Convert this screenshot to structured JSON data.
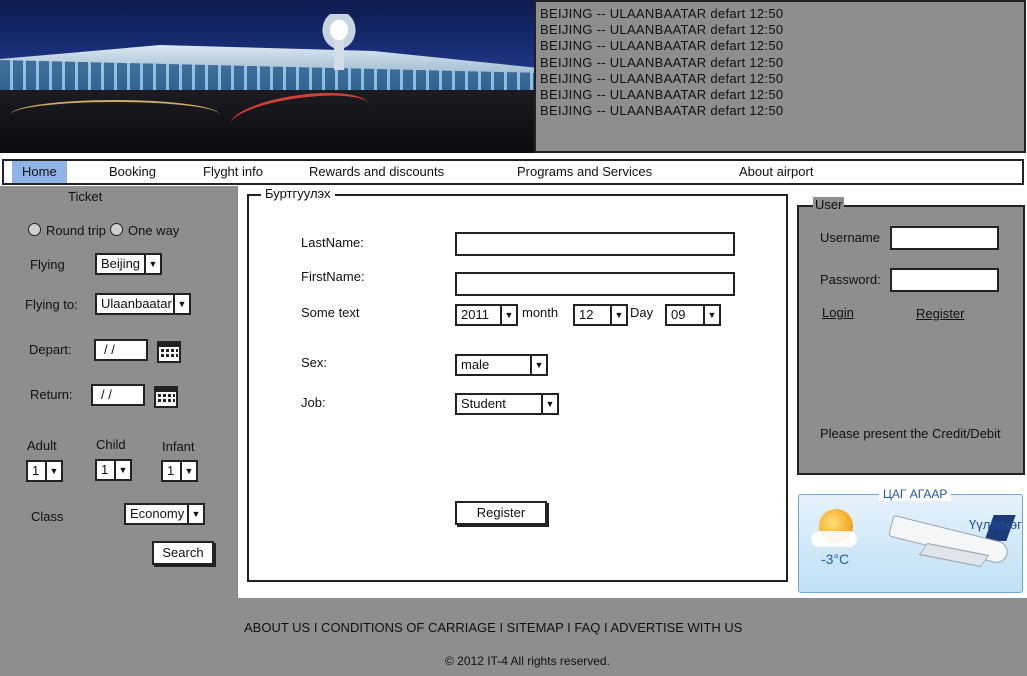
{
  "board": {
    "lines": [
      "BEIJING -- ULAANBAATAR defart 12:50",
      "BEIJING -- ULAANBAATAR defart 12:50",
      "BEIJING -- ULAANBAATAR defart 12:50",
      "BEIJING -- ULAANBAATAR defart 12:50",
      "BEIJING -- ULAANBAATAR defart 12:50",
      "BEIJING -- ULAANBAATAR defart 12:50",
      "BEIJING -- ULAANBAATAR defart 12:50"
    ]
  },
  "nav": {
    "items": [
      {
        "label": "Home",
        "active": true
      },
      {
        "label": "Booking"
      },
      {
        "label": "Flyght info"
      },
      {
        "label": "Rewards and discounts"
      },
      {
        "label": "Programs and Services"
      },
      {
        "label": "About airport"
      }
    ]
  },
  "ticket": {
    "title": "Ticket",
    "round_trip": "Round trip",
    "one_way": "One way",
    "flying_label": "Flying",
    "flying_value": "Beijing",
    "flying_to_label": "Flying to:",
    "flying_to_value": "Ulaanbaatar",
    "depart_label": "Depart:",
    "depart_value": "/ /",
    "return_label": "Return:",
    "return_value": "/ /",
    "adult_label": "Adult",
    "adult_value": "1",
    "child_label": "Child",
    "child_value": "1",
    "infant_label": "Infant",
    "infant_value": "1",
    "class_label": "Class",
    "class_value": "Economy",
    "search_label": "Search"
  },
  "registration": {
    "legend": "Буртгуулэх",
    "lastname_label": "LastName:",
    "lastname_value": "",
    "firstname_label": "FirstName:",
    "firstname_value": "",
    "some_text_label": "Some text",
    "year_value": "2011",
    "month_label": "month",
    "month_value": "12",
    "day_label": "Day",
    "day_value": "09",
    "sex_label": "Sex:",
    "sex_value": "male",
    "job_label": "Job:",
    "job_value": "Student",
    "register_label": "Register"
  },
  "user": {
    "legend": "User",
    "username_label": "Username",
    "username_value": "",
    "password_label": "Password:",
    "password_value": "",
    "login_label": "Login",
    "register_label": "Register",
    "notice": "Please present the Credit/Debit"
  },
  "weather": {
    "title": "ЦАГ АГААР",
    "temperature": "-3°C",
    "label": "Үүлэрхэг"
  },
  "footer": {
    "links": "ABOUT US I CONDITIONS OF CARRIAGE I SITEMAP I FAQ I ADVERTISE WITH US",
    "copyright": "© 2012 IT-4 All rights reserved."
  },
  "colors": {
    "panel_gray": "#8e8e8e",
    "nav_active": "#8fb4e6",
    "border": "#222222"
  }
}
